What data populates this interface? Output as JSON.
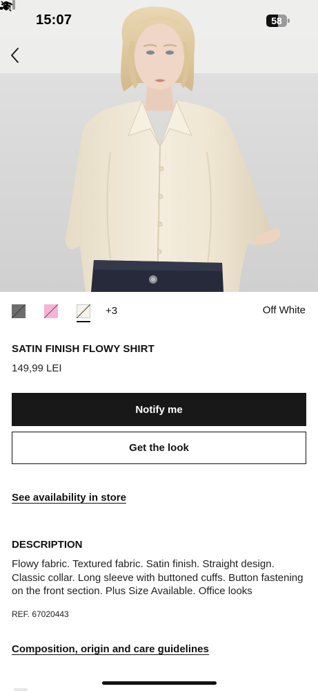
{
  "status_bar": {
    "time": "15:07",
    "battery_percent": "58",
    "battery_level": 0.58,
    "icons": [
      "bell-slash-icon",
      "cellular-signal-icon",
      "wifi-icon",
      "battery-icon"
    ]
  },
  "navigation": {
    "back_icon": "chevron-left-icon"
  },
  "product_image": {
    "colors": {
      "background": "#d6d7d6",
      "shirt": "#efe7d5",
      "jeans": "#262a3a"
    }
  },
  "colors": {
    "swatches": [
      {
        "name": "grey",
        "hex": "#6d6d6d"
      },
      {
        "name": "pink",
        "hex": "#f4b4d6"
      },
      {
        "name": "off-white",
        "hex": "#f8f4ea"
      }
    ],
    "more_label": "+3",
    "selected_name": "Off White",
    "selected_index": 2
  },
  "product": {
    "title": "SATIN FINISH FLOWY SHIRT",
    "price": "149,99 LEI"
  },
  "actions": {
    "notify_label": "Notify me",
    "look_label": "Get the look"
  },
  "availability": {
    "link_label": "See availability in store"
  },
  "description": {
    "heading": "DESCRIPTION",
    "text": "Flowy fabric. Textured fabric. Satin finish. Straight design. Classic collar. Long sleeve with buttoned cuffs. Button fastening on the front section. Plus Size Available. Office looks",
    "ref": "REF. 67020443"
  },
  "care": {
    "link_label": "Composition, origin and care guidelines"
  },
  "theme": {
    "primary": "#181818",
    "text": "#111111",
    "background": "#ffffff"
  }
}
